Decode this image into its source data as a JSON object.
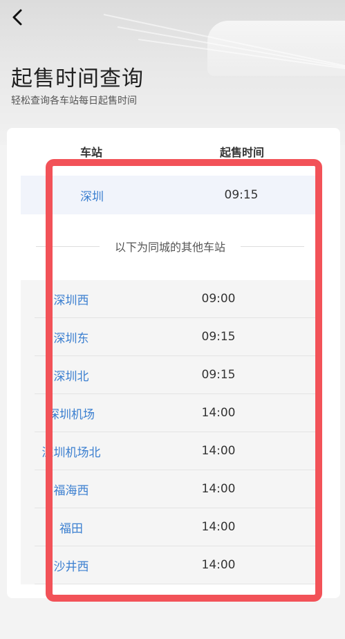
{
  "header": {
    "back_icon": "chevron-left-icon",
    "title": "起售时间查询",
    "subtitle": "轻松查询各车站每日起售时间"
  },
  "table": {
    "col_station": "车站",
    "col_time": "起售时间",
    "primary": {
      "station": "深圳",
      "time": "09:15"
    },
    "divider_text": "以下为同城的其他车站",
    "rows": [
      {
        "station": "深圳西",
        "time": "09:00"
      },
      {
        "station": "深圳东",
        "time": "09:15"
      },
      {
        "station": "深圳北",
        "time": "09:15"
      },
      {
        "station": "深圳机场",
        "time": "14:00"
      },
      {
        "station": "深圳机场北",
        "time": "14:00"
      },
      {
        "station": "福海西",
        "time": "14:00"
      },
      {
        "station": "福田",
        "time": "14:00"
      },
      {
        "station": "沙井西",
        "time": "14:00"
      }
    ]
  },
  "colors": {
    "station_link": "#3b7fd0",
    "highlight_border": "#f25258"
  }
}
